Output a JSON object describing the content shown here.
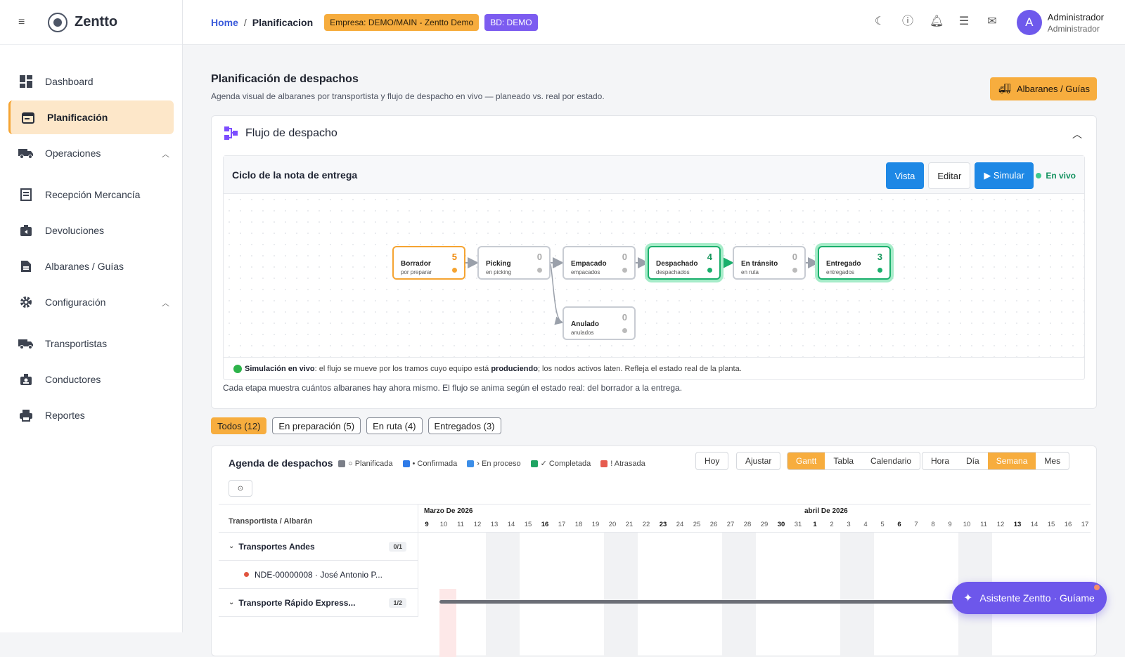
{
  "brand": {
    "name": "Zentto"
  },
  "sidebar": {
    "items": [
      {
        "label": "Dashboard"
      },
      {
        "label": "Planificación"
      },
      {
        "label": "Operaciones"
      },
      {
        "label": "Recepción Mercancía"
      },
      {
        "label": "Devoluciones"
      },
      {
        "label": "Albaranes / Guías"
      },
      {
        "label": "Configuración"
      },
      {
        "label": "Transportistas"
      },
      {
        "label": "Conductores"
      },
      {
        "label": "Reportes"
      }
    ]
  },
  "topbar": {
    "home": "Home",
    "sep": "/",
    "current": "Planificacion",
    "empresa": "Empresa: DEMO/MAIN - Zentto Demo",
    "bd": "BD: DEMO",
    "user_name": "Administrador",
    "user_role": "Administrador",
    "avatar_letter": "A"
  },
  "page": {
    "title": "Planificación de despachos",
    "subtitle": "Agenda visual de albaranes por transportista y flujo de despacho en vivo — planeado vs. real por estado.",
    "albaranes_button": "Albaranes / Guías"
  },
  "flow": {
    "title": "Flujo de despacho",
    "inner_title": "Ciclo de la nota de entrega",
    "btn_vista": "Vista",
    "btn_editar": "Editar",
    "btn_simular": "▶ Simular",
    "live": "En vivo",
    "nodes": [
      {
        "title": "Borrador",
        "sub": "por preparar",
        "count": "5"
      },
      {
        "title": "Picking",
        "sub": "en picking",
        "count": "0"
      },
      {
        "title": "Empacado",
        "sub": "empacados",
        "count": "0"
      },
      {
        "title": "Despachado",
        "sub": "despachados",
        "count": "4"
      },
      {
        "title": "En tránsito",
        "sub": "en ruta",
        "count": "0"
      },
      {
        "title": "Entregado",
        "sub": "entregados",
        "count": "3"
      },
      {
        "title": "Anulado",
        "sub": "anulados",
        "count": "0"
      }
    ],
    "sim_bold": "Simulación en vivo",
    "sim_text1": ": el flujo se mueve por los tramos cuyo equipo está ",
    "sim_bold2": "produciendo",
    "sim_text2": "; los nodos activos laten. Refleja el estado real de la planta.",
    "note": "Cada etapa muestra cuántos albaranes hay ahora mismo. El flujo se anima según el estado real: del borrador a la entrega."
  },
  "filters": [
    {
      "label": "Todos (12)"
    },
    {
      "label": "En preparación (5)"
    },
    {
      "label": "En ruta (4)"
    },
    {
      "label": "Entregados (3)"
    }
  ],
  "agenda": {
    "title": "Agenda de despachos",
    "legend": [
      "○ Planificada",
      "• Confirmada",
      "› En proceso",
      "✓ Completada",
      "! Atrasada"
    ],
    "legend_colors": [
      "#7b7f88",
      "#2f7be8",
      "#3c8ee8",
      "#1fa463",
      "#e65b4f"
    ],
    "btn_hoy": "Hoy",
    "btn_ajustar": "Ajustar",
    "views": [
      "Gantt",
      "Tabla",
      "Calendario"
    ],
    "scales": [
      "Hora",
      "Día",
      "Semana",
      "Mes"
    ],
    "zoom_icon": "⊙",
    "col_header": "Transportista / Albarán",
    "month1": "Marzo De 2026",
    "month2": "abril De 2026",
    "days": [
      "9",
      "10",
      "11",
      "12",
      "13",
      "14",
      "15",
      "16",
      "17",
      "18",
      "19",
      "20",
      "21",
      "22",
      "23",
      "24",
      "25",
      "26",
      "27",
      "28",
      "29",
      "30",
      "31",
      "1",
      "2",
      "3",
      "4",
      "5",
      "6",
      "7",
      "8",
      "9",
      "10",
      "11",
      "12",
      "13",
      "14",
      "15",
      "16",
      "17"
    ],
    "rows": [
      {
        "name": "Transportes Andes",
        "count": "0/1"
      },
      {
        "name": "NDE-00000008 · José Antonio P..."
      },
      {
        "name": "Transporte Rápido Express...",
        "count": "1/2"
      }
    ]
  },
  "assistant": {
    "label": "Asistente Zentto · Guíame"
  }
}
